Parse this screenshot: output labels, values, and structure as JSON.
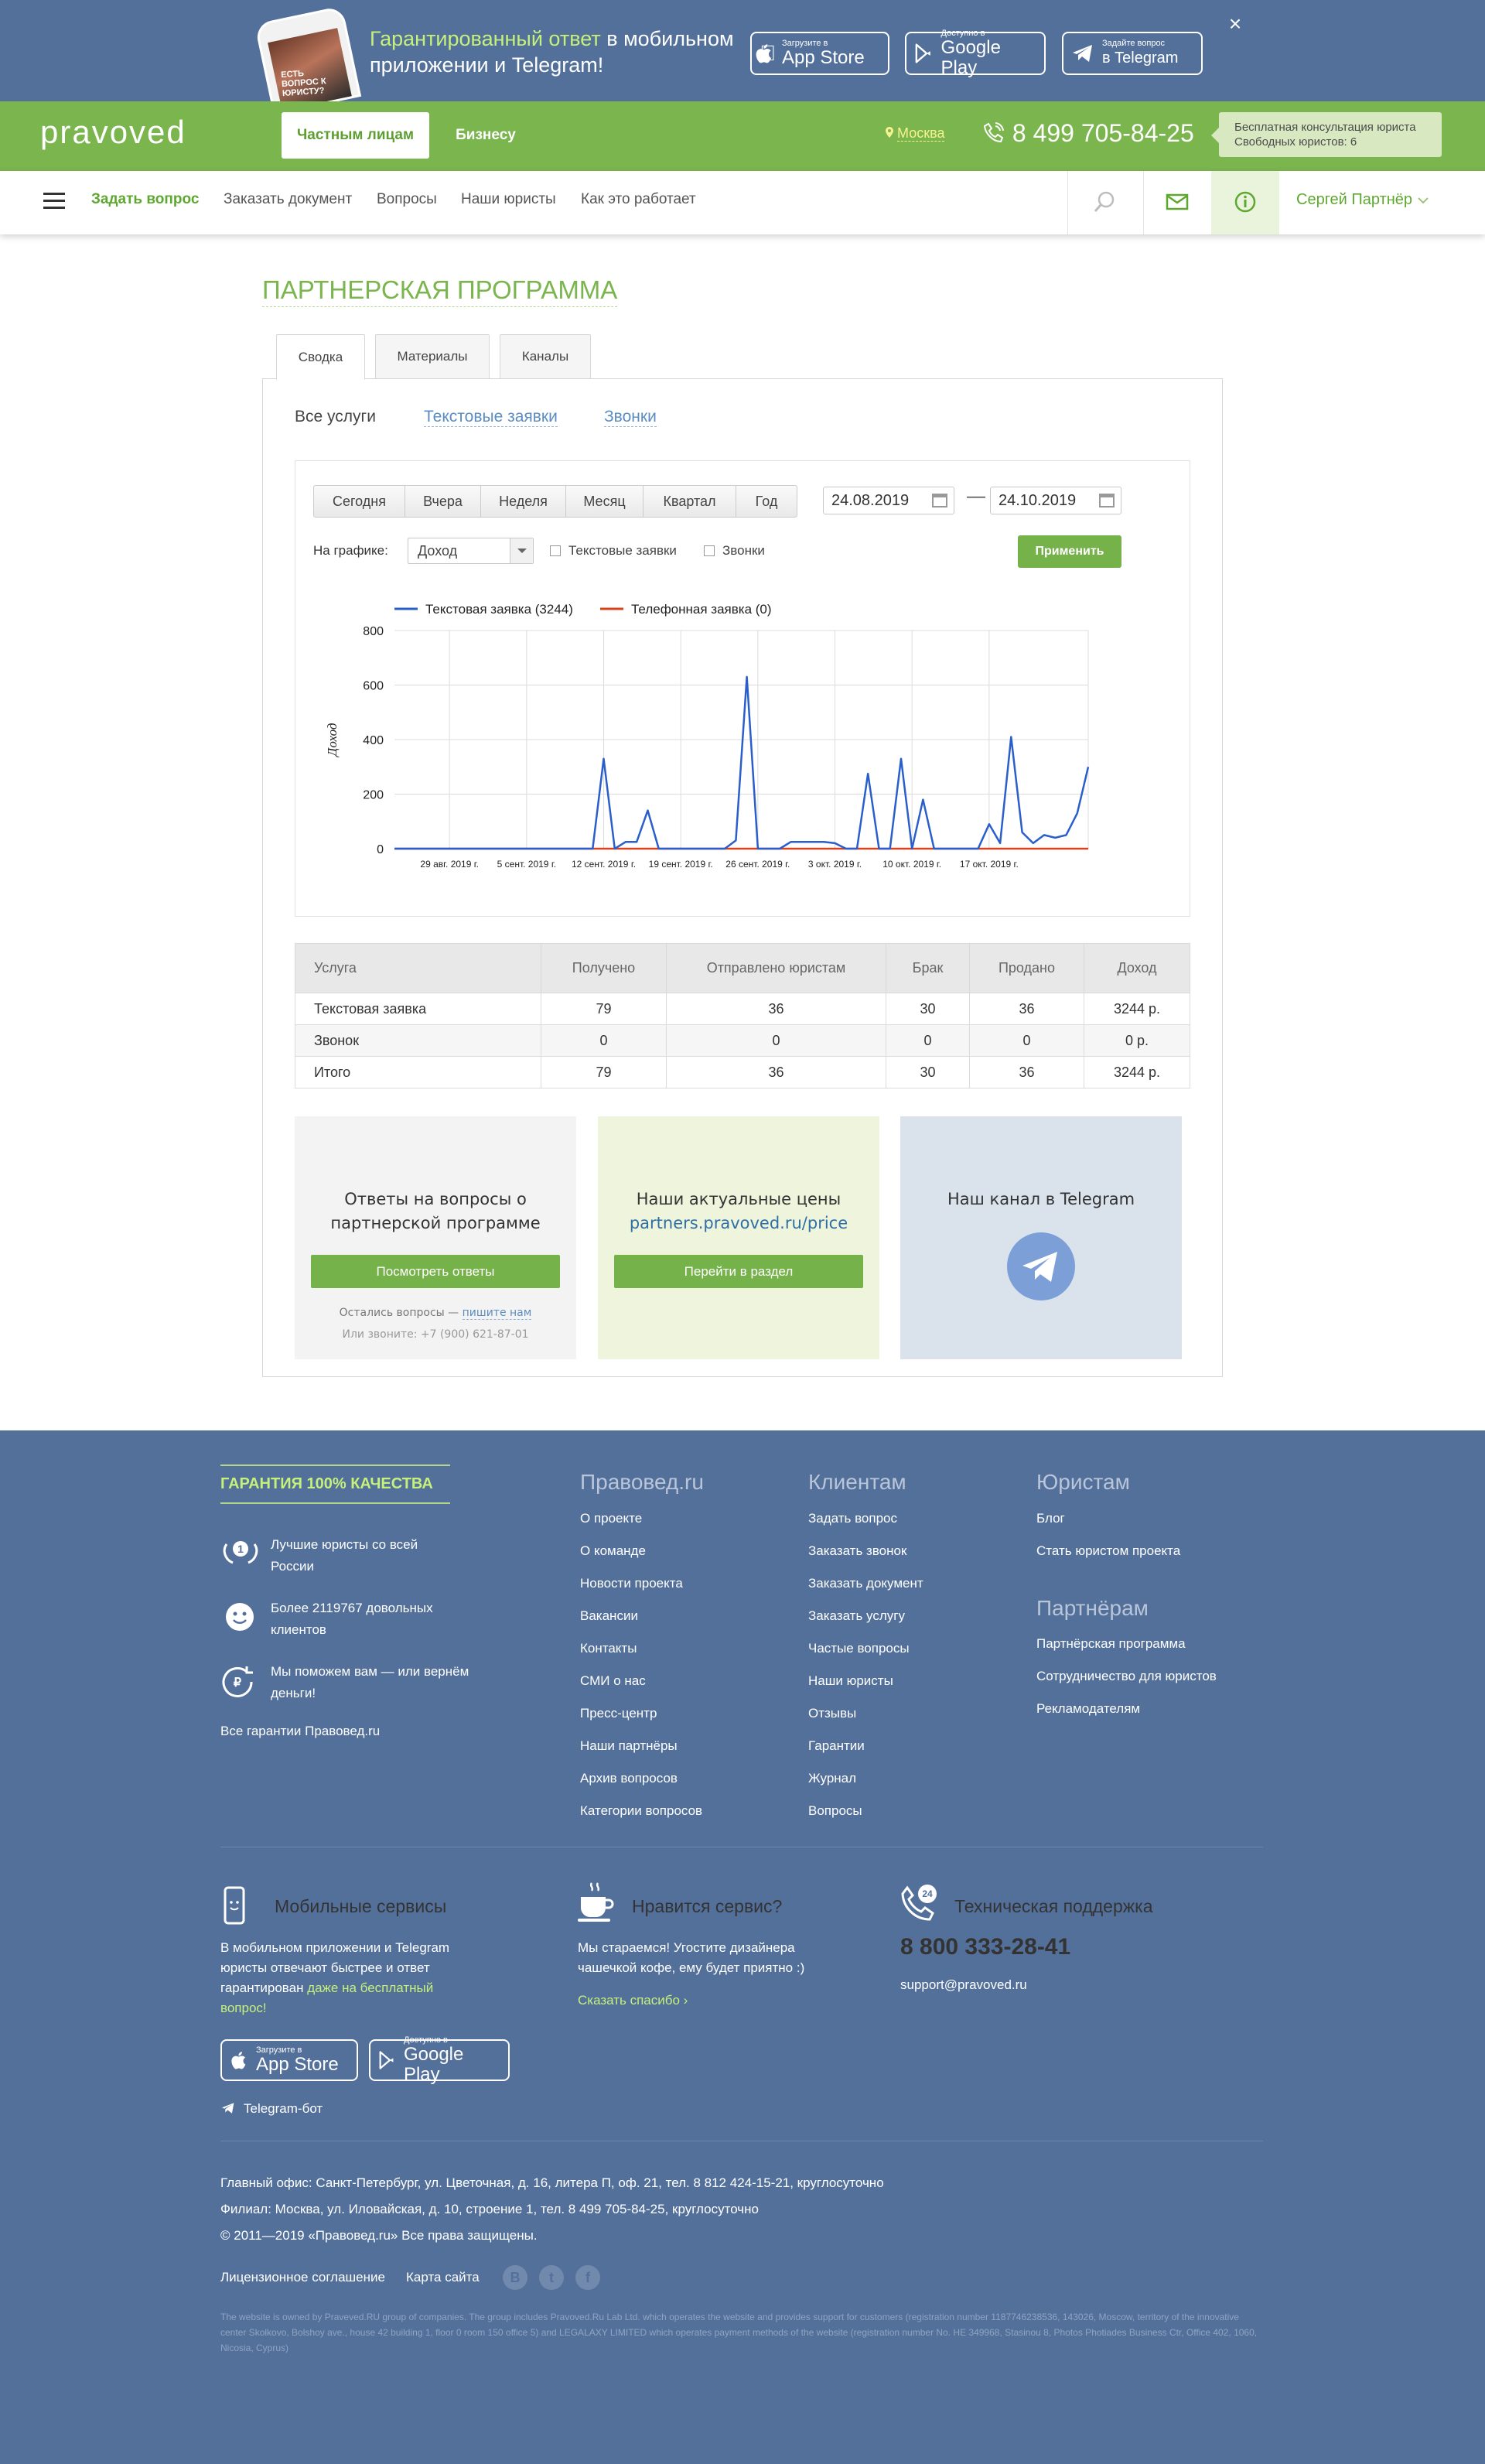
{
  "promo": {
    "text_hl": "Гарантированный ответ",
    "text_rest1": " в мобильном",
    "text_rest2": "приложении и Telegram!",
    "phone_screen": "ЕСТЬ ВОПРОС К ЮРИСТУ?",
    "appstore_small": "Загрузите в",
    "appstore_big": "App Store",
    "gplay_small": "Доступно в",
    "gplay_big": "Google Play",
    "tg_small": "Задайте вопрос",
    "tg_big": "в Telegram",
    "close": "×"
  },
  "header": {
    "logo": "pravoved",
    "tab_private": "Частным лицам",
    "tab_business": "Бизнесу",
    "city": "Москва",
    "phone": "8 499 705-84-25",
    "consult_line1": "Бесплатная консультация юриста",
    "consult_line2": "Свободных юристов: 6"
  },
  "nav": {
    "ask": "Задать вопрос",
    "order_doc": "Заказать документ",
    "questions": "Вопросы",
    "lawyers": "Наши юристы",
    "how": "Как это работает",
    "user": "Сергей Партнёр"
  },
  "page": {
    "title": "ПАРТНЕРСКАЯ ПРОГРАММА",
    "tabs": [
      "Сводка",
      "Материалы",
      "Каналы"
    ],
    "services": [
      "Все услуги",
      "Текстовые заявки",
      "Звонки"
    ]
  },
  "filters": {
    "ranges": [
      "Сегодня",
      "Вчера",
      "Неделя",
      "Месяц",
      "Квартал",
      "Год"
    ],
    "date_from": "24.08.2019",
    "date_to": "24.10.2019",
    "dash": "—",
    "on_chart": "На графике:",
    "metric": "Доход",
    "chk_text": "Текстовые заявки",
    "chk_calls": "Звонки",
    "apply": "Применить"
  },
  "chart_data": {
    "type": "line",
    "ylabel": "Доход",
    "ylim": [
      0,
      800
    ],
    "yticks": [
      0,
      200,
      400,
      600,
      800
    ],
    "xticklabels": [
      "29 авг. 2019 г.",
      "5 сент. 2019 г.",
      "12 сент. 2019 г.",
      "19 сент. 2019 г.",
      "26 сент. 2019 г.",
      "3 окт. 2019 г.",
      "10 окт. 2019 г.",
      "17 окт. 2019 г."
    ],
    "x_start": "2019-08-24",
    "x_end": "2019-10-24",
    "legend_position": "top-left",
    "series": [
      {
        "name": "Текстовая заявка (3244)",
        "color": "#2a5fcb",
        "values": [
          0,
          0,
          0,
          0,
          0,
          0,
          0,
          0,
          0,
          0,
          0,
          0,
          0,
          0,
          0,
          0,
          0,
          0,
          0,
          330,
          0,
          25,
          25,
          140,
          0,
          0,
          0,
          0,
          0,
          0,
          0,
          30,
          630,
          0,
          0,
          0,
          25,
          25,
          25,
          25,
          20,
          0,
          0,
          275,
          0,
          0,
          330,
          0,
          180,
          0,
          0,
          0,
          0,
          0,
          90,
          20,
          410,
          60,
          20,
          50,
          40,
          50,
          130,
          300
        ]
      },
      {
        "name": "Телефонная заявка (0)",
        "color": "#d9421a",
        "values": [
          0,
          0,
          0,
          0,
          0,
          0,
          0,
          0,
          0,
          0,
          0,
          0,
          0,
          0,
          0,
          0,
          0,
          0,
          0,
          0,
          0,
          0,
          0,
          0,
          0,
          0,
          0,
          0,
          0,
          0,
          0,
          0,
          0,
          0,
          0,
          0,
          0,
          0,
          0,
          0,
          0,
          0,
          0,
          0,
          0,
          0,
          0,
          0,
          0,
          0,
          0,
          0,
          0,
          0,
          0,
          0,
          0,
          0,
          0,
          0,
          0,
          0,
          0,
          0
        ]
      }
    ]
  },
  "table": {
    "headers": [
      "Услуга",
      "Получено",
      "Отправлено юристам",
      "Брак",
      "Продано",
      "Доход"
    ],
    "rows": [
      [
        "Текстовая заявка",
        "79",
        "36",
        "30",
        "36",
        "3244 р."
      ],
      [
        "Звонок",
        "0",
        "0",
        "0",
        "0",
        "0 р."
      ],
      [
        "Итого",
        "79",
        "36",
        "30",
        "36",
        "3244 р."
      ]
    ]
  },
  "cards": {
    "faq_title1": "Ответы на вопросы о",
    "faq_title2": "партнерской программе",
    "faq_btn": "Посмотреть ответы",
    "faq_note1": "Остались вопросы —",
    "faq_note_link": "пишите нам",
    "faq_note2": "Или звоните: +7 (900) 621-87-01",
    "prices_title": "Наши актуальные цены",
    "prices_link": "partners.pravoved.ru/price",
    "prices_btn": "Перейти в раздел",
    "tg_title": "Наш канал в Telegram"
  },
  "footer": {
    "guarantee_title": "ГАРАНТИЯ 100% КАЧЕСТВА",
    "g1": "Лучшие юристы со всей России",
    "g2": "Более 2119767 довольных клиентов",
    "g3": "Мы поможем вам — или вернём деньги!",
    "g_all": "Все гарантии Правовед.ru",
    "col1_title": "Правовед.ru",
    "col1": [
      "О проекте",
      "О команде",
      "Новости проекта",
      "Вакансии",
      "Контакты",
      "СМИ о нас",
      "Пресс-центр",
      "Наши партнёры",
      "Архив вопросов",
      "Категории вопросов"
    ],
    "col2_title": "Клиентам",
    "col2": [
      "Задать вопрос",
      "Заказать звонок",
      "Заказать документ",
      "Заказать услугу",
      "Частые вопросы",
      "Наши юристы",
      "Отзывы",
      "Гарантии",
      "Журнал",
      "Вопросы"
    ],
    "col3_title": "Юристам",
    "col3": [
      "Блог",
      "Стать юристом проекта"
    ],
    "col4_title": "Партнёрам",
    "col4": [
      "Партнёрская программа",
      "Сотрудничество для юристов",
      "Рекламодателям"
    ],
    "mobile_title": "Мобильные сервисы",
    "mobile_text1": "В мобильном приложении и Telegram юристы отвечают быстрее и ответ гарантирован ",
    "mobile_text_hl": "даже на бесплатный вопрос!",
    "like_title": "Нравится сервис?",
    "like_text": "Мы стараемся! Угостите дизайнера чашечкой кофе, ему будет приятно :)",
    "like_link": "Сказать спасибо ›",
    "support_title": "Техническая поддержка",
    "support_phone": "8 800 333-28-41",
    "support_email": "support@pravoved.ru",
    "support_badge": "24",
    "tg_bot": "Telegram-бот",
    "office": "Главный офис: Санкт-Петербург, ул. Цветочная, д. 16, литера П, оф. 21, тел. 8 812 424-15-21, круглосуточно",
    "branch": "Филиал: Москва, ул. Иловайская, д. 10, строение 1, тел. 8 499 705-84-25, круглосуточно",
    "copyright": "© 2011—2019 «Правовед.ru» Все права защищены.",
    "license": "Лицензионное соглашение",
    "sitemap": "Карта сайта",
    "social": [
      "B",
      "t",
      "f"
    ],
    "legal": "The website is owned by Praveved.RU group of companies. The group includes Pravoved.Ru Lab Ltd. which operates the website and provides support for customers (registration number 1187746238536, 143026, Moscow, territory of the innovative center Skolkovo, Bolshoy ave., house 42 building 1, floor 0 room 150 office 5) and LEGALAXY LIMITED which operates payment methods of the website (registration number No. HE 349968, Stasinou 8, Photos Photiades Business Ctr, Office 402, 1060, Nicosia, Cyprus)"
  }
}
